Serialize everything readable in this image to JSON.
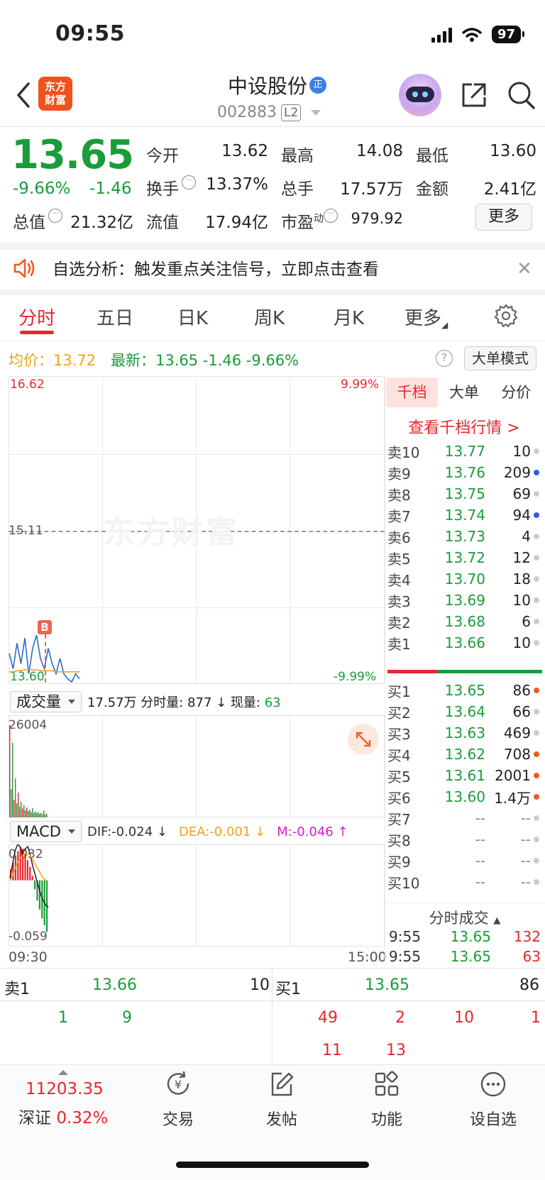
{
  "status_bar": {
    "time": "09:55",
    "battery": "97"
  },
  "header": {
    "logo_line1": "东方",
    "logo_line2": "财富",
    "stock_name": "中设股份",
    "badge": "正",
    "stock_code": "002883",
    "level_tag": "L2"
  },
  "quote": {
    "price": "13.65",
    "pct_change": "-9.66%",
    "abs_change": "-1.46",
    "open_label": "今开",
    "open": "13.62",
    "high_label": "最高",
    "high": "14.08",
    "low_label": "最低",
    "low": "13.60",
    "turnover_label": "换手",
    "turnover": "13.37%",
    "volume_label": "总手",
    "volume": "17.57万",
    "amount_label": "金额",
    "amount": "2.41亿",
    "mktcap_label": "总值",
    "mktcap": "21.32亿",
    "float_label": "流值",
    "float_cap": "17.94亿",
    "pe_label": "市盈",
    "pe_sup": "动",
    "pe": "979.92",
    "more_label": "更多"
  },
  "alert": {
    "text": "自选分析：触发重点关注信号，立即点击查看"
  },
  "tabs": [
    "分时",
    "五日",
    "日K",
    "周K",
    "月K",
    "更多"
  ],
  "info_row": {
    "avg": "均价：13.72",
    "latest": "最新：13.65  -1.46  -9.66%",
    "big_order_mode": "大单模式"
  },
  "chart_data": {
    "type": "line",
    "y_max": "16.62",
    "y_mid": "15.11",
    "y_min": "13.60",
    "pct_max": "9.99%",
    "pct_min": "-9.99%",
    "watermark": "东方财富",
    "buy_marker": "B",
    "price_series": [
      13.9,
      13.75,
      14.0,
      13.8,
      14.05,
      13.7,
      13.95,
      14.08,
      13.85,
      13.75,
      13.95,
      13.8,
      13.7,
      13.85,
      13.7,
      13.65,
      13.62,
      13.7,
      13.65
    ],
    "avg_series": [
      13.72,
      13.72,
      13.73,
      13.73,
      13.74,
      13.74,
      13.74,
      13.74,
      13.73,
      13.73,
      13.73,
      13.73,
      13.72,
      13.72,
      13.72,
      13.72,
      13.72,
      13.72,
      13.72
    ],
    "volume": {
      "label": "成交量",
      "summary": "17.57万  分时量: 877 ↓  现量: ",
      "current": "63",
      "max_label": "26004",
      "bars": [
        26004,
        8000,
        21000,
        5000,
        11000,
        4000,
        7000,
        3000,
        4500,
        2500,
        3500,
        2000,
        2800,
        1800,
        2200,
        1500,
        2600,
        1300,
        1700,
        1200,
        1500,
        1000,
        1300,
        900,
        1900,
        800,
        1100
      ]
    },
    "macd": {
      "label": "MACD",
      "dif": "DIF:-0.024 ↓",
      "dea": "DEA:-0.001 ↓",
      "m": "M:-0.046 ↑",
      "top_label": "0.032",
      "bottom_label": "-0.059",
      "hist": [
        0.01,
        0.016,
        0.022,
        0.026,
        0.03,
        0.028,
        0.024,
        0.018,
        0.012,
        0.004,
        -0.008,
        -0.018,
        -0.026,
        -0.034,
        -0.04,
        -0.046
      ],
      "dif_series": [
        0.002,
        0.014,
        0.026,
        0.032,
        0.03,
        0.024,
        0.028,
        0.03,
        0.022,
        0.012,
        0.004,
        -0.004,
        -0.012,
        -0.018,
        -0.022,
        -0.024
      ],
      "dea_series": [
        0.0,
        0.004,
        0.01,
        0.016,
        0.02,
        0.022,
        0.024,
        0.024,
        0.022,
        0.018,
        0.014,
        0.01,
        0.006,
        0.002,
        0.0,
        -0.001
      ]
    },
    "x_start": "09:30",
    "x_end": "15:00"
  },
  "depth": {
    "tabs": [
      "千档",
      "大单",
      "分价"
    ],
    "view_link": "查看千档行情 >",
    "asks": [
      {
        "lv": "卖10",
        "price": "13.77",
        "vol": "10",
        "dot": ""
      },
      {
        "lv": "卖9",
        "price": "13.76",
        "vol": "209",
        "dot": "blue"
      },
      {
        "lv": "卖8",
        "price": "13.75",
        "vol": "69",
        "dot": ""
      },
      {
        "lv": "卖7",
        "price": "13.74",
        "vol": "94",
        "dot": "blue"
      },
      {
        "lv": "卖6",
        "price": "13.73",
        "vol": "4",
        "dot": ""
      },
      {
        "lv": "卖5",
        "price": "13.72",
        "vol": "12",
        "dot": ""
      },
      {
        "lv": "卖4",
        "price": "13.70",
        "vol": "18",
        "dot": ""
      },
      {
        "lv": "卖3",
        "price": "13.69",
        "vol": "10",
        "dot": ""
      },
      {
        "lv": "卖2",
        "price": "13.68",
        "vol": "6",
        "dot": ""
      },
      {
        "lv": "卖1",
        "price": "13.66",
        "vol": "10",
        "dot": ""
      }
    ],
    "bids": [
      {
        "lv": "买1",
        "price": "13.65",
        "vol": "86",
        "dot": "org"
      },
      {
        "lv": "买2",
        "price": "13.64",
        "vol": "66",
        "dot": ""
      },
      {
        "lv": "买3",
        "price": "13.63",
        "vol": "469",
        "dot": ""
      },
      {
        "lv": "买4",
        "price": "13.62",
        "vol": "708",
        "dot": "org"
      },
      {
        "lv": "买5",
        "price": "13.61",
        "vol": "2001",
        "dot": "org"
      },
      {
        "lv": "买6",
        "price": "13.60",
        "vol": "1.4万",
        "dot": "org"
      },
      {
        "lv": "买7",
        "price": "--",
        "vol": "--",
        "dot": ""
      },
      {
        "lv": "买8",
        "price": "--",
        "vol": "--",
        "dot": ""
      },
      {
        "lv": "买9",
        "price": "--",
        "vol": "--",
        "dot": ""
      },
      {
        "lv": "买10",
        "price": "--",
        "vol": "--",
        "dot": ""
      }
    ],
    "ticks_header": "分时成交",
    "ticks": [
      {
        "t": "9:55",
        "p": "13.65",
        "v": "132"
      },
      {
        "t": "9:55",
        "p": "13.65",
        "v": "63"
      }
    ]
  },
  "strip": {
    "ask1_label": "卖1",
    "ask1_price": "13.66",
    "ask1_vol": "10",
    "bid1_label": "买1",
    "bid1_price": "13.65",
    "bid1_vol": "86",
    "ask_queue": [
      "1",
      "9"
    ],
    "bid_queue_row1": [
      "49",
      "2",
      "10",
      "1"
    ],
    "bid_queue_row2": [
      "11",
      "13"
    ]
  },
  "bottom_nav": {
    "index_value": "11203.35",
    "index_name": "深证",
    "index_pct": "0.32%",
    "items": [
      "交易",
      "发帖",
      "功能",
      "设自选"
    ]
  }
}
